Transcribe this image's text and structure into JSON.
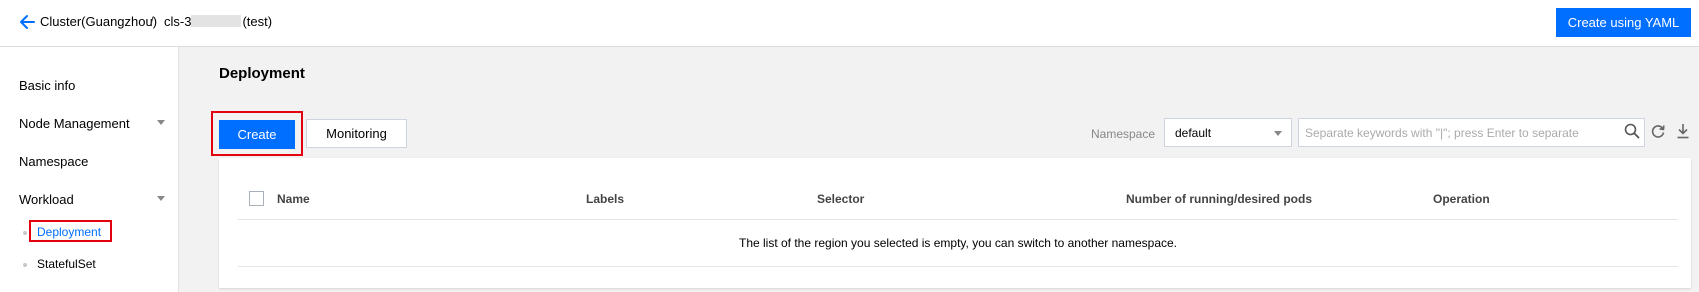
{
  "header": {
    "breadcrumb": {
      "cluster": "Cluster(Guangzhou)",
      "separator": "/",
      "cluster_id_prefix": "cls-3",
      "cluster_id_suffix": "(test)"
    },
    "yaml_button": "Create using YAML"
  },
  "sidebar": {
    "basic_info": "Basic info",
    "node_management": "Node Management",
    "namespace": "Namespace",
    "workload": "Workload",
    "sub_items": {
      "deployment": "Deployment",
      "statefulset": "StatefulSet"
    }
  },
  "main": {
    "title": "Deployment",
    "create_button": "Create",
    "monitoring_button": "Monitoring",
    "namespace_label": "Namespace",
    "namespace_value": "default",
    "search_placeholder": "Separate keywords with \"|\"; press Enter to separate"
  },
  "table": {
    "columns": [
      "Name",
      "Labels",
      "Selector",
      "Number of running/desired pods",
      "Operation"
    ],
    "empty_message": "The list of the region you selected is empty, you can switch to another namespace."
  },
  "colors": {
    "primary": "#006eff",
    "highlight_border": "#e3000f",
    "background": "#f2f2f2"
  }
}
